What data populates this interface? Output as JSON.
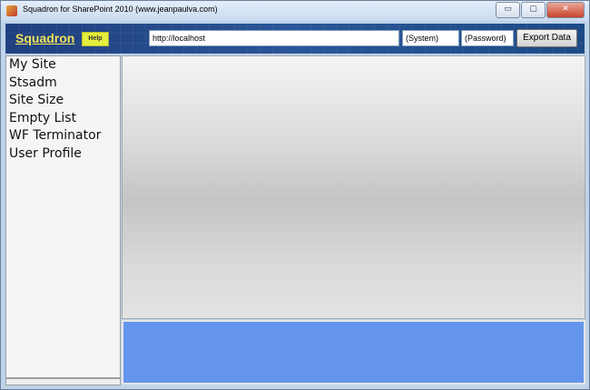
{
  "window": {
    "title": "Squadron for SharePoint  2010 (www.jeanpaulva.com)",
    "minimize": "▭",
    "maximize": "▢",
    "close": "✕"
  },
  "header": {
    "logo": "Squadron",
    "help_label": "Help",
    "url": "http://localhost",
    "user": "(System)",
    "password": "(Password)",
    "export_label": "Export Data"
  },
  "sidebar": {
    "items": [
      {
        "label": "My Site"
      },
      {
        "label": "Stsadm"
      },
      {
        "label": "Site Size"
      },
      {
        "label": "Empty List"
      },
      {
        "label": "WF Terminator"
      },
      {
        "label": "User Profile"
      }
    ]
  },
  "colors": {
    "header": "#2a5598",
    "logo": "#f2e25a",
    "help": "#e4ee3c",
    "bottom_panel": "#6495ed"
  }
}
